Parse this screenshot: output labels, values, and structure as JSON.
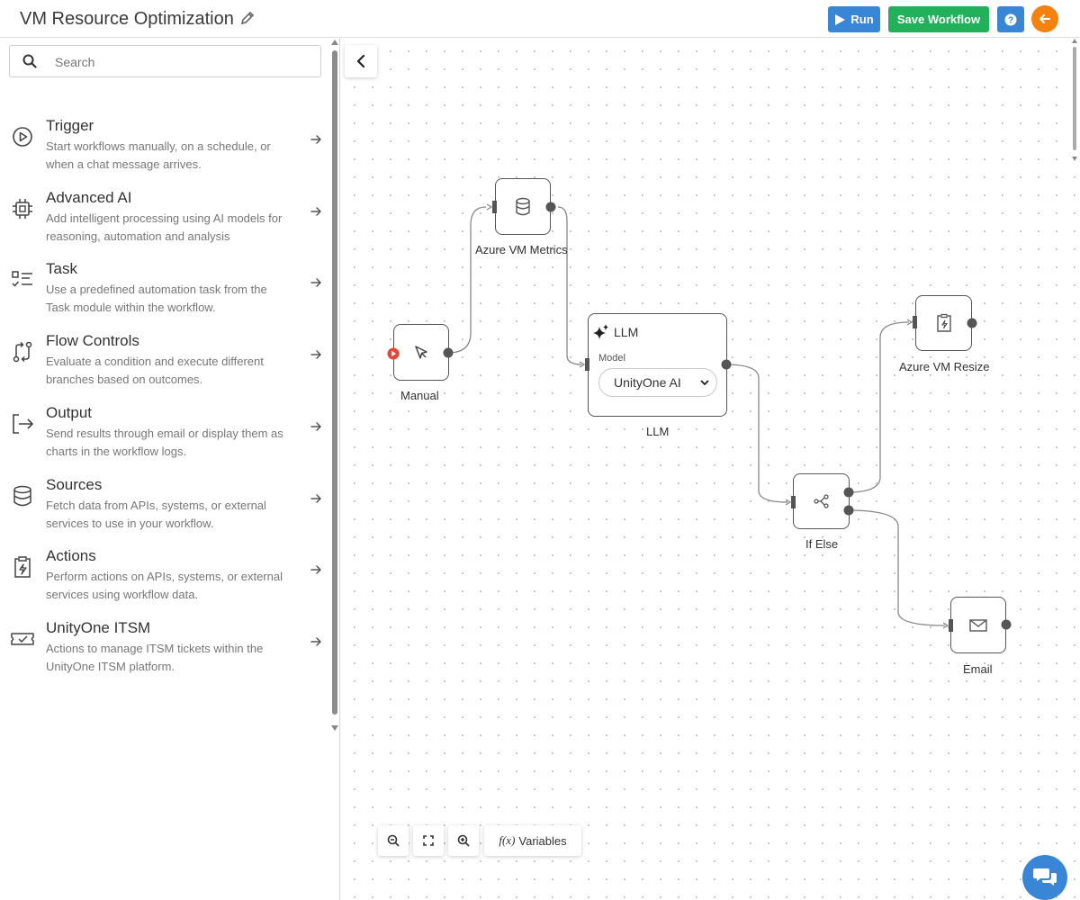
{
  "header": {
    "title": "VM Resource Optimization",
    "run_label": "Run",
    "save_label": "Save Workflow",
    "help_label": "?"
  },
  "sidebar": {
    "search_placeholder": "Search",
    "categories": [
      {
        "title": "Trigger",
        "desc": "Start workflows manually, on a schedule, or when a chat message arrives.",
        "icon": "play-circle-icon"
      },
      {
        "title": "Advanced AI",
        "desc": "Add intelligent processing using AI models for reasoning, automation and analysis",
        "icon": "chip-icon"
      },
      {
        "title": "Task",
        "desc": "Use a predefined automation task from the Task module within the workflow.",
        "icon": "checklist-icon"
      },
      {
        "title": "Flow Controls",
        "desc": "Evaluate a condition and execute different branches based on outcomes.",
        "icon": "flow-icon"
      },
      {
        "title": "Output",
        "desc": "Send results through email or display them as charts in the workflow logs.",
        "icon": "output-icon"
      },
      {
        "title": "Sources",
        "desc": "Fetch data from APIs, systems, or external services to use in your workflow.",
        "icon": "database-icon"
      },
      {
        "title": "Actions",
        "desc": "Perform actions on APIs, systems, or external services using workflow data.",
        "icon": "clipboard-bolt-icon"
      },
      {
        "title": "UnityOne ITSM",
        "desc": "Actions to manage ITSM tickets within the UnityOne ITSM platform.",
        "icon": "ticket-icon"
      }
    ]
  },
  "canvas": {
    "nodes": {
      "manual": "Manual",
      "metrics": "Azure VM Metrics",
      "llm": {
        "title": "LLM",
        "model_label": "Model",
        "model_value": "UnityOne AI",
        "caption": "LLM"
      },
      "ifelse": "If Else",
      "resize": "Azure VM Resize",
      "email": "Email"
    },
    "tools": {
      "variables_label": "Variables",
      "variables_prefix": "f(x)"
    }
  },
  "colors": {
    "run": "#3a86d6",
    "save": "#22b05a",
    "back": "#f5820f",
    "chat": "#3a86d6"
  }
}
